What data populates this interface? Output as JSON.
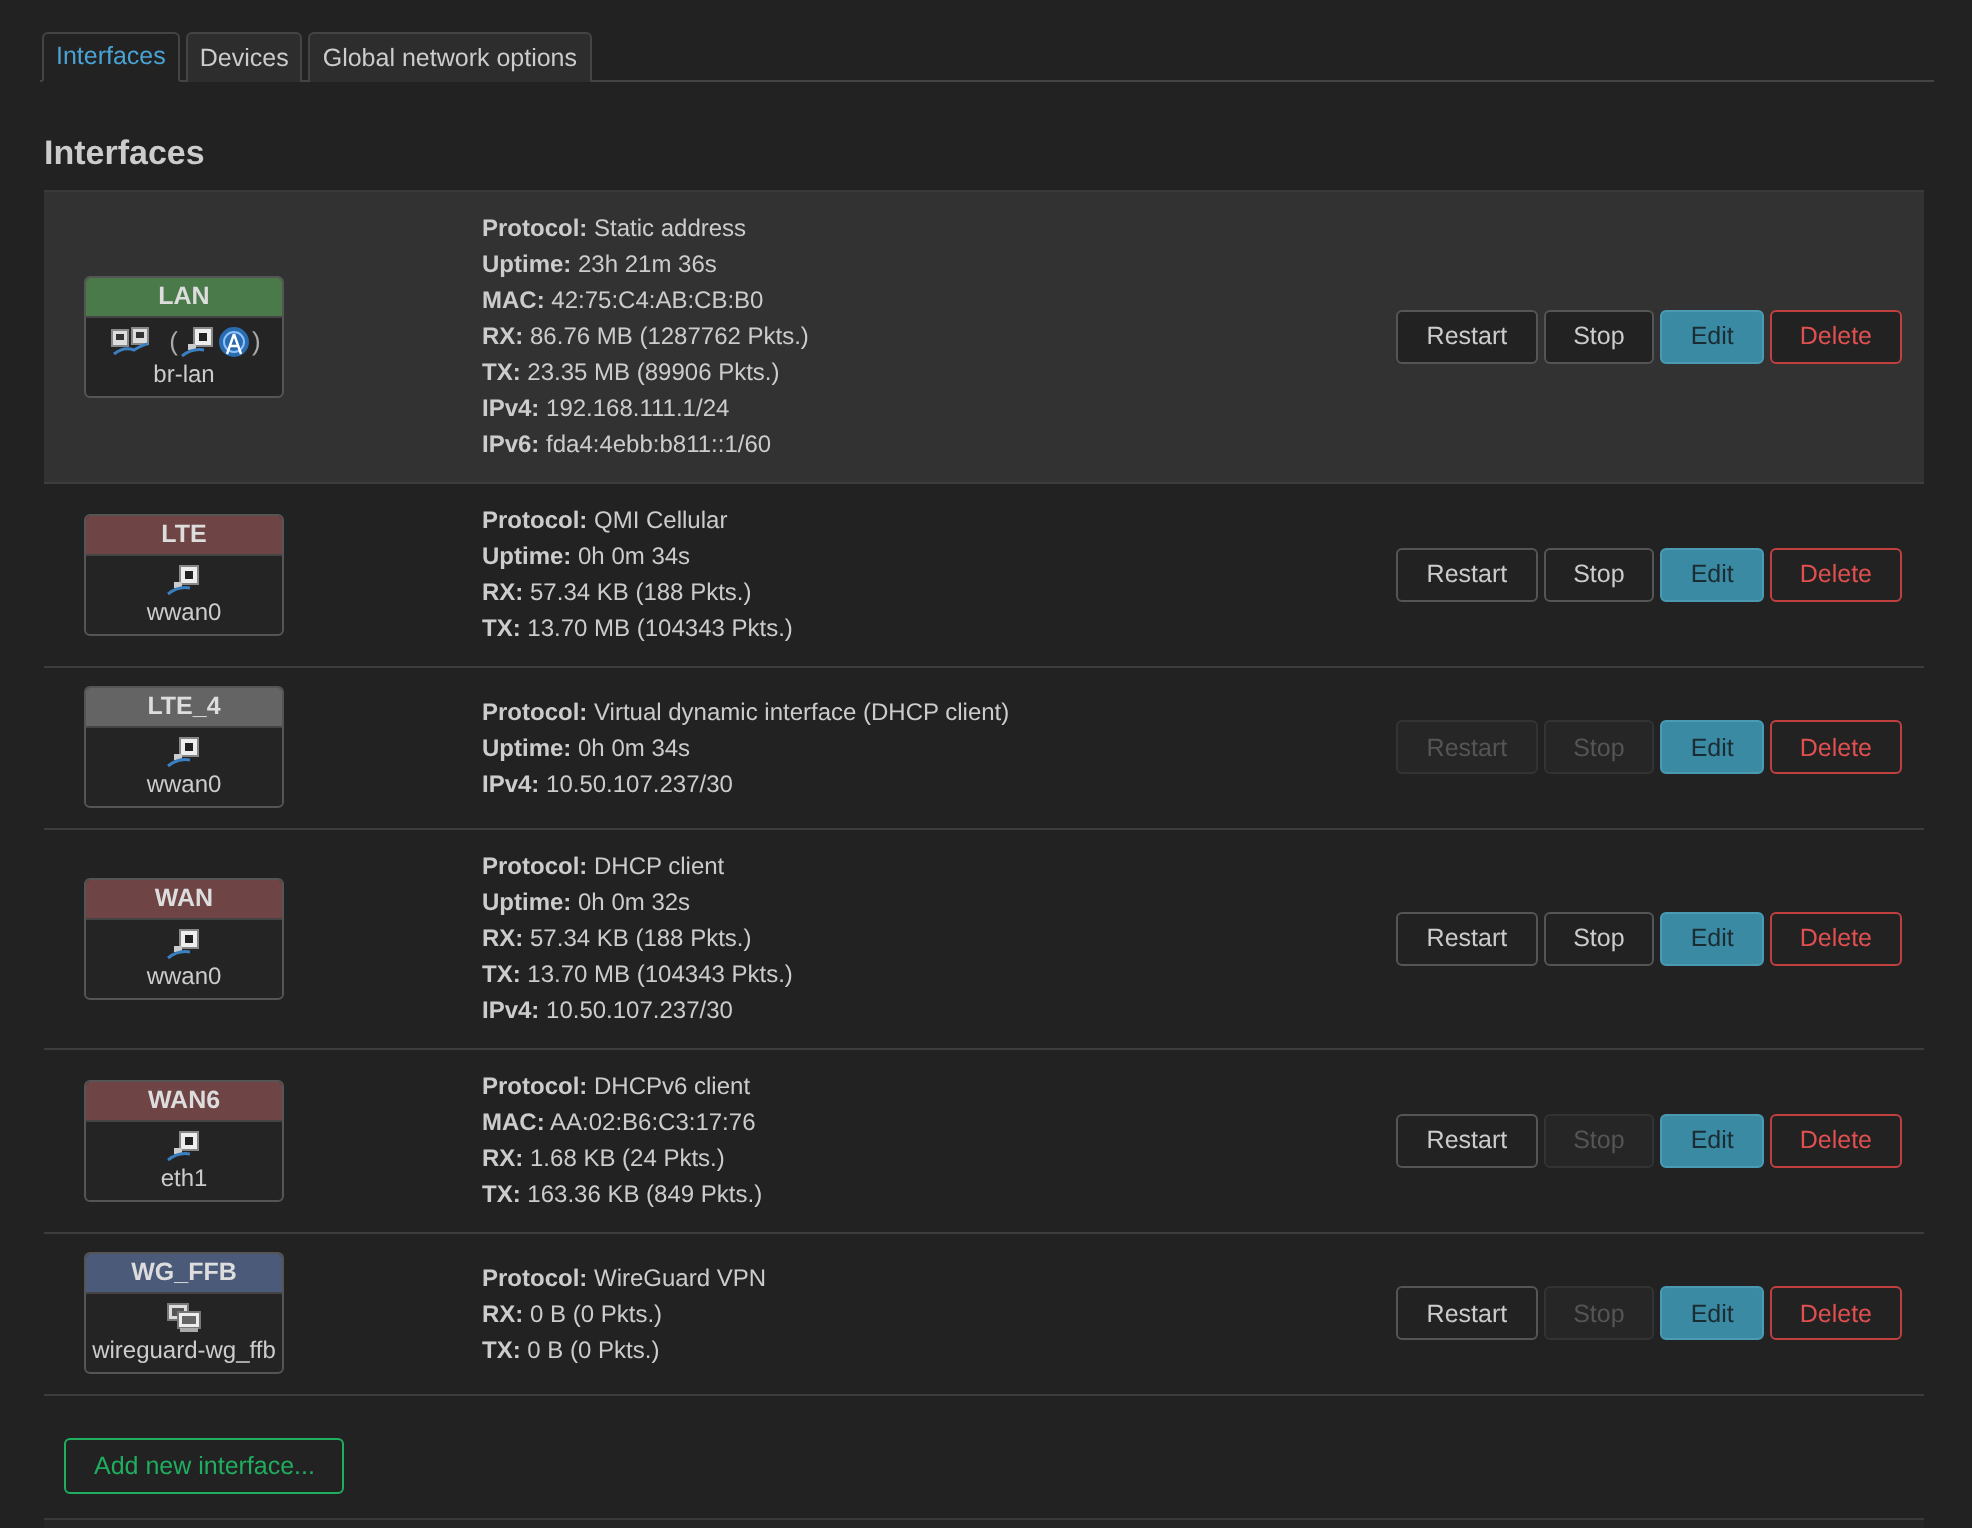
{
  "tabs": [
    {
      "label": "Interfaces",
      "selected": true
    },
    {
      "label": "Devices",
      "selected": false
    },
    {
      "label": "Global network options",
      "selected": false
    }
  ],
  "heading": "Interfaces",
  "interfaces": [
    {
      "name": "LAN",
      "color": "#4a7a4a",
      "highlighted": true,
      "devices": [
        {
          "kind": "bridge"
        },
        {
          "kind": "text",
          "text": "("
        },
        {
          "kind": "ethernet"
        },
        {
          "kind": "wifi"
        },
        {
          "kind": "text",
          "text": ")"
        }
      ],
      "device_name": "br-lan",
      "details": [
        {
          "label": "Protocol:",
          "value": "Static address"
        },
        {
          "label": "Uptime:",
          "value": "23h 21m 36s"
        },
        {
          "label": "MAC:",
          "value": "42:75:C4:AB:CB:B0"
        },
        {
          "label": "RX:",
          "value": "86.76 MB (1287762 Pkts.)"
        },
        {
          "label": "TX:",
          "value": "23.35 MB (89906 Pkts.)"
        },
        {
          "label": "IPv4:",
          "value": "192.168.111.1/24"
        },
        {
          "label": "IPv6:",
          "value": "fda4:4ebb:b811::1/60"
        }
      ],
      "buttons": [
        {
          "label": "Restart",
          "kind": "restart",
          "disabled": false
        },
        {
          "label": "Stop",
          "kind": "stop",
          "disabled": false
        },
        {
          "label": "Edit",
          "kind": "edit",
          "disabled": false
        },
        {
          "label": "Delete",
          "kind": "delete",
          "disabled": false
        }
      ]
    },
    {
      "name": "LTE",
      "color": "#6e4444",
      "highlighted": false,
      "devices": [
        {
          "kind": "ethernet"
        }
      ],
      "device_name": "wwan0",
      "details": [
        {
          "label": "Protocol:",
          "value": "QMI Cellular"
        },
        {
          "label": "Uptime:",
          "value": "0h 0m 34s"
        },
        {
          "label": "RX:",
          "value": "57.34 KB (188 Pkts.)"
        },
        {
          "label": "TX:",
          "value": "13.70 MB (104343 Pkts.)"
        }
      ],
      "buttons": [
        {
          "label": "Restart",
          "kind": "restart",
          "disabled": false
        },
        {
          "label": "Stop",
          "kind": "stop",
          "disabled": false
        },
        {
          "label": "Edit",
          "kind": "edit",
          "disabled": false
        },
        {
          "label": "Delete",
          "kind": "delete",
          "disabled": false
        }
      ]
    },
    {
      "name": "LTE_4",
      "color": "#646464",
      "highlighted": false,
      "devices": [
        {
          "kind": "ethernet"
        }
      ],
      "device_name": "wwan0",
      "details": [
        {
          "label": "Protocol:",
          "value": "Virtual dynamic interface (DHCP client)"
        },
        {
          "label": "Uptime:",
          "value": "0h 0m 34s"
        },
        {
          "label": "IPv4:",
          "value": "10.50.107.237/30"
        }
      ],
      "buttons": [
        {
          "label": "Restart",
          "kind": "restart",
          "disabled": true
        },
        {
          "label": "Stop",
          "kind": "stop",
          "disabled": true
        },
        {
          "label": "Edit",
          "kind": "edit",
          "disabled": false
        },
        {
          "label": "Delete",
          "kind": "delete",
          "disabled": false
        }
      ]
    },
    {
      "name": "WAN",
      "color": "#6e4444",
      "highlighted": false,
      "devices": [
        {
          "kind": "ethernet"
        }
      ],
      "device_name": "wwan0",
      "details": [
        {
          "label": "Protocol:",
          "value": "DHCP client"
        },
        {
          "label": "Uptime:",
          "value": "0h 0m 32s"
        },
        {
          "label": "RX:",
          "value": "57.34 KB (188 Pkts.)"
        },
        {
          "label": "TX:",
          "value": "13.70 MB (104343 Pkts.)"
        },
        {
          "label": "IPv4:",
          "value": "10.50.107.237/30"
        }
      ],
      "buttons": [
        {
          "label": "Restart",
          "kind": "restart",
          "disabled": false
        },
        {
          "label": "Stop",
          "kind": "stop",
          "disabled": false
        },
        {
          "label": "Edit",
          "kind": "edit",
          "disabled": false
        },
        {
          "label": "Delete",
          "kind": "delete",
          "disabled": false
        }
      ]
    },
    {
      "name": "WAN6",
      "color": "#6e4444",
      "highlighted": false,
      "devices": [
        {
          "kind": "ethernet"
        }
      ],
      "device_name": "eth1",
      "details": [
        {
          "label": "Protocol:",
          "value": "DHCPv6 client"
        },
        {
          "label": "MAC:",
          "value": "AA:02:B6:C3:17:76"
        },
        {
          "label": "RX:",
          "value": "1.68 KB (24 Pkts.)"
        },
        {
          "label": "TX:",
          "value": "163.36 KB (849 Pkts.)"
        }
      ],
      "buttons": [
        {
          "label": "Restart",
          "kind": "restart",
          "disabled": false
        },
        {
          "label": "Stop",
          "kind": "stop",
          "disabled": true
        },
        {
          "label": "Edit",
          "kind": "edit",
          "disabled": false
        },
        {
          "label": "Delete",
          "kind": "delete",
          "disabled": false
        }
      ]
    },
    {
      "name": "WG_FFB",
      "color": "#4a5a78",
      "highlighted": false,
      "devices": [
        {
          "kind": "computers"
        }
      ],
      "device_name": "wireguard-wg_ffb",
      "details": [
        {
          "label": "Protocol:",
          "value": "WireGuard VPN"
        },
        {
          "label": "RX:",
          "value": "0 B (0 Pkts.)"
        },
        {
          "label": "TX:",
          "value": "0 B (0 Pkts.)"
        }
      ],
      "buttons": [
        {
          "label": "Restart",
          "kind": "restart",
          "disabled": false
        },
        {
          "label": "Stop",
          "kind": "stop",
          "disabled": true
        },
        {
          "label": "Edit",
          "kind": "edit",
          "disabled": false
        },
        {
          "label": "Delete",
          "kind": "delete",
          "disabled": false
        }
      ]
    }
  ],
  "add_button": "Add new interface..."
}
